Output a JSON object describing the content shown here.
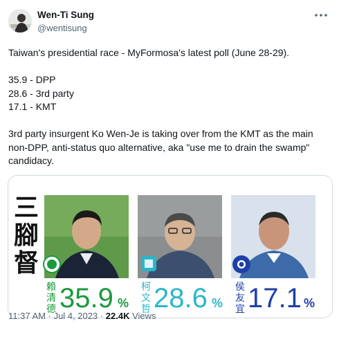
{
  "author": {
    "name": "Wen-Ti Sung",
    "handle": "@wentisung"
  },
  "tweet": {
    "lines": [
      "Taiwan's presidential race - MyFormosa's latest poll (June 28-29).",
      "",
      "35.9 - DPP",
      "28.6 - 3rd party",
      "17.1 - KMT",
      "",
      "3rd party insurgent Ko Wen-Je is taking over from the KMT as the main",
      "non-DPP, anti-status quo alternative, aka \"use me to drain the swamp\"",
      "candidacy."
    ]
  },
  "media": {
    "vertical_title": [
      "三",
      "腳",
      "督"
    ],
    "candidates": [
      {
        "name_chars": [
          "賴",
          "清",
          "德"
        ],
        "value": "35.9",
        "unit": "%",
        "color": "#1a9a3c"
      },
      {
        "name_chars": [
          "柯",
          "文",
          "哲"
        ],
        "value": "28.6",
        "unit": "%",
        "color": "#2bb6c9"
      },
      {
        "name_chars": [
          "侯",
          "友",
          "宜"
        ],
        "value": "17.1",
        "unit": "%",
        "color": "#1f3fa8"
      }
    ]
  },
  "meta": {
    "time": "11:37 AM",
    "separator": "·",
    "date": "Jul 4, 2023",
    "views_count": "22.4K",
    "views_label": "Views"
  },
  "icons": {
    "more": "more-horizontal-icon"
  }
}
